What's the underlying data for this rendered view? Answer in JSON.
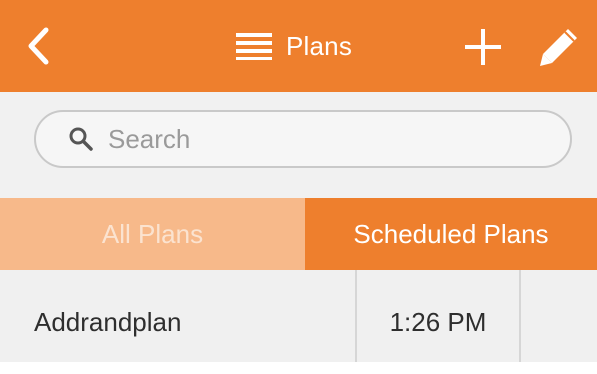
{
  "header": {
    "title": "Plans",
    "back_icon": "chevron-left-icon",
    "menu_icon": "list-icon",
    "add_icon": "plus-icon",
    "edit_icon": "pencil-icon",
    "background_color": "#ee7f2d"
  },
  "search": {
    "placeholder": "Search",
    "value": "",
    "icon": "search-icon"
  },
  "tabs": [
    {
      "label": "All Plans",
      "selected": false
    },
    {
      "label": "Scheduled Plans",
      "selected": true
    }
  ],
  "plans": [
    {
      "name": "Addrandplan",
      "time": "1:26 PM"
    }
  ],
  "colors": {
    "accent": "#ee7f2d",
    "tab_inactive": "#f7b98a"
  }
}
